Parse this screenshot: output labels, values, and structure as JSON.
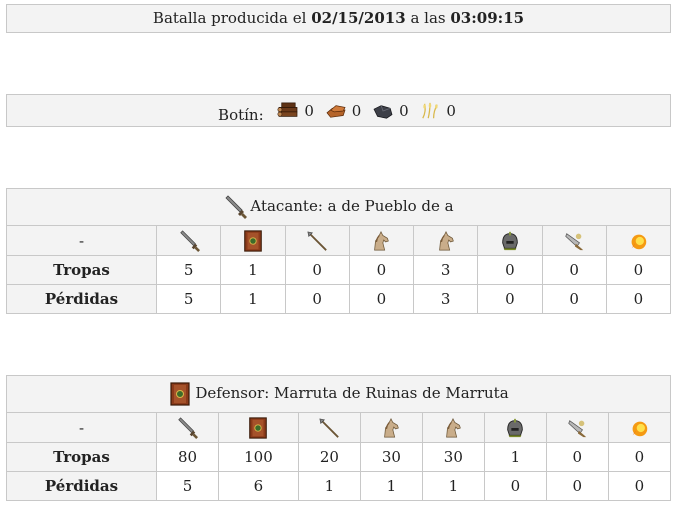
{
  "header": {
    "prefix": "Batalla producida el",
    "date": "02/15/2013",
    "mid": "a las",
    "time": "03:09:15"
  },
  "loot": {
    "label": "Botín:",
    "items": [
      {
        "icon": "wood-icon",
        "value": "0"
      },
      {
        "icon": "clay-icon",
        "value": "0"
      },
      {
        "icon": "iron-icon",
        "value": "0"
      },
      {
        "icon": "crop-icon",
        "value": "0"
      }
    ]
  },
  "attacker": {
    "title": "Atacante: a de Pueblo de a",
    "dash": "-",
    "units": [
      "sword-icon",
      "shield-icon",
      "spear-icon",
      "horse-icon",
      "horse-icon",
      "helmet-icon",
      "catapult-icon",
      "fireball-icon"
    ],
    "rows": [
      {
        "label": "Tropas",
        "values": [
          "5",
          "1",
          "0",
          "0",
          "3",
          "0",
          "0",
          "0"
        ]
      },
      {
        "label": "Pérdidas",
        "values": [
          "5",
          "1",
          "0",
          "0",
          "3",
          "0",
          "0",
          "0"
        ]
      }
    ]
  },
  "defender": {
    "title": "Defensor: Marruta de Ruinas de Marruta",
    "dash": "-",
    "units": [
      "sword-icon",
      "shield-icon",
      "spear-icon",
      "horse-icon",
      "horse-icon",
      "helmet-icon",
      "catapult-icon",
      "fireball-icon"
    ],
    "rows": [
      {
        "label": "Tropas",
        "values": [
          "80",
          "100",
          "20",
          "30",
          "30",
          "1",
          "0",
          "0"
        ]
      },
      {
        "label": "Pérdidas",
        "values": [
          "5",
          "6",
          "1",
          "1",
          "1",
          "0",
          "0",
          "0"
        ]
      }
    ]
  }
}
